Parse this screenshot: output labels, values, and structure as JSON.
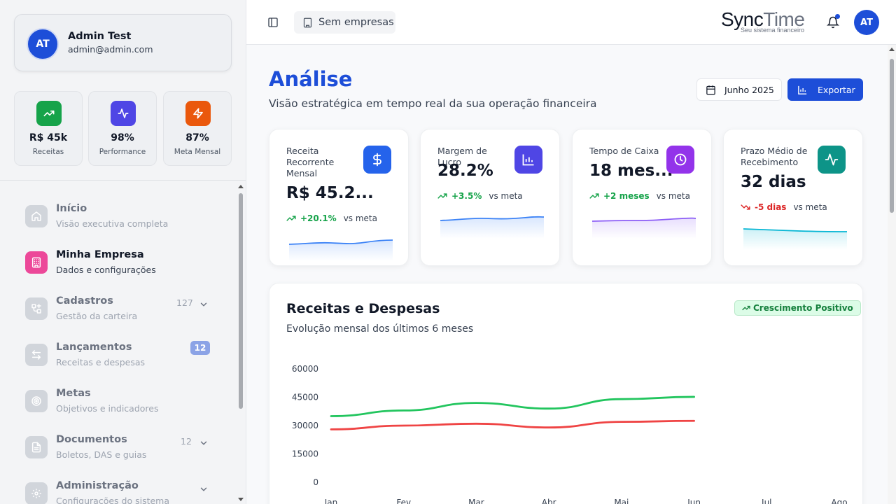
{
  "user": {
    "initials": "AT",
    "name": "Admin Test",
    "email": "admin@admin.com"
  },
  "sidebar_stats": [
    {
      "value": "R$ 45k",
      "label": "Receitas",
      "icon": "trending-up-icon",
      "color": "#16a34a"
    },
    {
      "value": "98%",
      "label": "Performance",
      "icon": "activity-icon",
      "color": "#4f46e5"
    },
    {
      "value": "87%",
      "label": "Meta Mensal",
      "icon": "zap-icon",
      "color": "#ea580c"
    }
  ],
  "nav": [
    {
      "title": "Início",
      "sub": "Visão executiva completa",
      "icon": "home-icon"
    },
    {
      "title": "Minha Empresa",
      "sub": "Dados e configurações",
      "icon": "building-icon",
      "active": true,
      "color": "#ec4899"
    },
    {
      "title": "Cadastros",
      "sub": "Gestão da carteira",
      "icon": "network-icon",
      "count": "127"
    },
    {
      "title": "Lançamentos",
      "sub": "Receitas e despesas",
      "icon": "arrows-icon",
      "badge": "12"
    },
    {
      "title": "Metas",
      "sub": "Objetivos e indicadores",
      "icon": "target-icon"
    },
    {
      "title": "Documentos",
      "sub": "Boletos, DAS e guias",
      "icon": "document-icon",
      "count": "12"
    },
    {
      "title": "Administração",
      "sub": "Configurações do sistema",
      "icon": "gear-icon"
    }
  ],
  "header": {
    "company": "Sem empresas",
    "brand_dark": "Sync",
    "brand_light": "Time",
    "brand_tagline": "Seu sistema financeiro",
    "avatar": "AT"
  },
  "page": {
    "title": "Análise",
    "subtitle": "Visão estratégica em tempo real da sua operação financeira",
    "date": "Junho 2025",
    "export": "Exportar"
  },
  "kpis": [
    {
      "title": "Receita Recorrente Mensal",
      "value": "R$ 45.2...",
      "delta": "+20.1%",
      "vs": "vs meta",
      "trend": "up",
      "icon": "dollar-icon",
      "color": "#2563eb",
      "spark_color": "#3b82f6"
    },
    {
      "title": "Margem de Lucro",
      "value": "28.2%",
      "delta": "+3.5%",
      "vs": "vs meta",
      "trend": "up",
      "icon": "bar-chart-icon",
      "color": "#4f46e5",
      "spark_color": "#3b82f6"
    },
    {
      "title": "Tempo de Caixa",
      "value": "18 mes...",
      "delta": "+2 meses",
      "vs": "vs meta",
      "trend": "up",
      "icon": "clock-icon",
      "color": "#9333ea",
      "spark_color": "#8b5cf6"
    },
    {
      "title": "Prazo Médio de Recebimento",
      "value": "32 dias",
      "delta": "-5 dias",
      "vs": "vs meta",
      "trend": "down",
      "icon": "pulse-icon",
      "color": "#0d9488",
      "spark_color": "#06b6d4"
    }
  ],
  "chart_section": {
    "title": "Receitas e Despesas",
    "subtitle": "Evolução mensal dos últimos 6 meses",
    "badge": "Crescimento Positivo"
  },
  "chart_data": {
    "type": "line",
    "categories": [
      "Jan",
      "Fev",
      "Mar",
      "Abr",
      "Mai",
      "Jun",
      "Jul",
      "Ago"
    ],
    "y_ticks": [
      60000,
      45000,
      30000,
      15000,
      0
    ],
    "ylim": [
      0,
      60000
    ],
    "series": [
      {
        "values": [
          35000,
          38000,
          42000,
          39000,
          44000,
          45200,
          null,
          null
        ],
        "color": "#22c55e"
      },
      {
        "values": [
          28000,
          30000,
          31000,
          29000,
          32000,
          32500,
          null,
          null
        ],
        "color": "#ef4444"
      }
    ]
  }
}
